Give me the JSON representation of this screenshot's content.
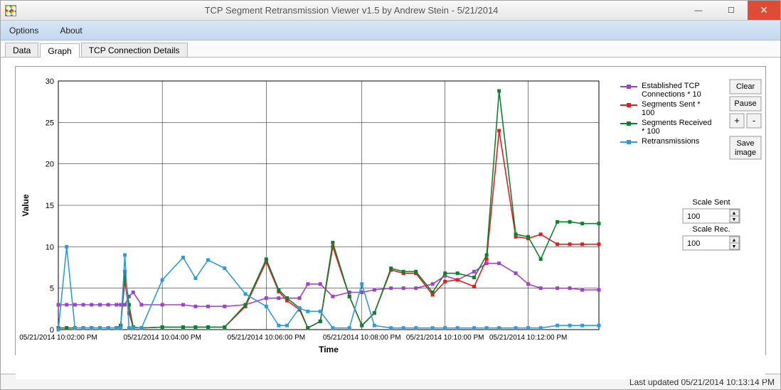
{
  "window": {
    "title": "TCP Segment Retransmission Viewer v1.5 by Andrew Stein - 5/21/2014"
  },
  "menubar": {
    "options": "Options",
    "about": "About"
  },
  "tabs": {
    "data": "Data",
    "graph": "Graph",
    "details": "TCP Connection Details"
  },
  "buttons": {
    "clear": "Clear",
    "pause": "Pause",
    "plus": "+",
    "minus": "-",
    "save": "Save image"
  },
  "scale": {
    "sent_label": "Scale Sent",
    "sent_value": "100",
    "rec_label": "Scale Rec.",
    "rec_value": "100"
  },
  "status": {
    "text": "Last updated 05/21/2014 10:13:14 PM"
  },
  "chart_data": {
    "type": "line",
    "xlabel": "Time",
    "ylabel": "Value",
    "ylim": [
      0,
      30
    ],
    "x_ticks": [
      "05/21/2014 10:02:00 PM",
      "05/21/2014 10:04:00 PM",
      "05/21/2014 10:06:00 PM",
      "05/21/2014 10:08:00 PM",
      "05/21/2014 10:10:00 PM",
      "05/21/2014 10:12:00 PM"
    ],
    "x": [
      0,
      0.2,
      0.4,
      0.6,
      0.8,
      1.0,
      1.2,
      1.4,
      1.5,
      1.6,
      1.7,
      1.8,
      2.0,
      2.5,
      3.0,
      3.3,
      3.6,
      4.0,
      4.5,
      5.0,
      5.3,
      5.5,
      5.8,
      6.0,
      6.3,
      6.6,
      7.0,
      7.3,
      7.6,
      8.0,
      8.3,
      8.6,
      9.0,
      9.3,
      9.6,
      10.0,
      10.3,
      10.6,
      11.0,
      11.3,
      11.6,
      12.0,
      12.3,
      12.6,
      13.0
    ],
    "legend": {
      "established": "Established TCP Connections * 10",
      "sent": "Segments Sent * 100",
      "received": "Segments Received * 100",
      "retrans": "Retransmissions"
    },
    "series": [
      {
        "name": "Established TCP Connections * 10",
        "color": "#a040d0",
        "values": [
          3,
          3,
          3,
          3,
          3,
          3,
          3,
          3,
          3,
          3,
          4,
          4.5,
          3,
          3,
          3,
          2.8,
          2.8,
          2.8,
          3,
          3.8,
          3.8,
          3.8,
          3.8,
          5.5,
          5.5,
          4,
          4.5,
          4.5,
          4.8,
          5,
          5,
          5,
          5.5,
          6.5,
          6,
          7,
          8,
          8,
          6.8,
          5.5,
          5,
          5,
          5,
          4.8,
          4.8
        ]
      },
      {
        "name": "Segments Sent * 100",
        "color": "#e02020",
        "values": [
          0.2,
          0.2,
          0.2,
          0.2,
          0.2,
          0.2,
          0.2,
          0.2,
          0.5,
          6,
          2,
          0.3,
          0.2,
          0.3,
          0.3,
          0.3,
          0.3,
          0.3,
          2.8,
          8.2,
          4.6,
          3.5,
          2.4,
          0.2,
          1,
          10,
          4,
          0.5,
          2,
          7.2,
          6.8,
          6.8,
          4.2,
          5.8,
          6,
          5.2,
          8.5,
          24,
          11.2,
          11,
          11.5,
          10.3,
          10.3,
          10.3,
          10.3
        ]
      },
      {
        "name": "Segments Received * 100",
        "color": "#108030",
        "values": [
          0.2,
          0.2,
          0.2,
          0.2,
          0.2,
          0.2,
          0.2,
          0.2,
          0.5,
          7,
          3,
          0.3,
          0.2,
          0.3,
          0.3,
          0.3,
          0.3,
          0.3,
          3,
          8.5,
          4.8,
          3.8,
          2.6,
          0.2,
          1,
          10.5,
          4,
          0.5,
          2,
          7.4,
          7,
          7,
          4.5,
          6.8,
          6.8,
          6.3,
          9,
          28.8,
          11.5,
          11.2,
          8.5,
          13,
          13,
          12.8,
          12.8
        ]
      },
      {
        "name": "Retransmissions",
        "color": "#3399dd",
        "values": [
          0,
          10,
          0.2,
          0.2,
          0.2,
          0.2,
          0.2,
          0.2,
          0.2,
          9,
          0.2,
          0.2,
          0.2,
          6,
          8.7,
          6.2,
          8.4,
          7.4,
          4.3,
          2.8,
          0.5,
          0.5,
          2.6,
          2.2,
          2.2,
          0.2,
          0.2,
          5.5,
          0.5,
          0.2,
          0.2,
          0.2,
          0.2,
          0.2,
          0.2,
          0.2,
          0.2,
          0.2,
          0.2,
          0.2,
          0.2,
          0.5,
          0.5,
          0.5,
          0.5
        ]
      }
    ]
  }
}
